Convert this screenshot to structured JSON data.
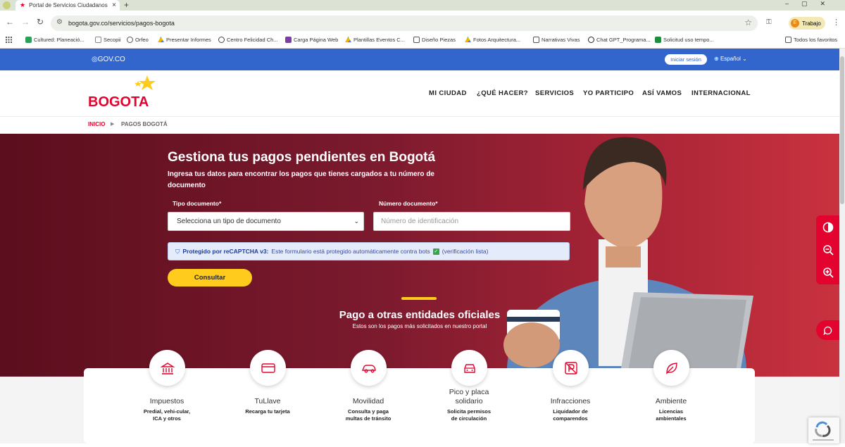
{
  "browser": {
    "tab_title": "Portal de Servicios Ciudadanos",
    "url": "bogota.gov.co/servicios/pagos-bogota",
    "profile_initial": "E",
    "profile_label": "Trabajo",
    "bookmarks": [
      {
        "label": "Cultured: Planeació...",
        "icon": "green-square-icon",
        "color": "#2e9e5b"
      },
      {
        "label": "Secopii",
        "icon": "blank-page-icon",
        "color": "#ffffff"
      },
      {
        "label": "Orfeo",
        "icon": "orfeo-icon",
        "color": "#555555"
      },
      {
        "label": "Presentar Informes",
        "icon": "drive-icon",
        "color": "#f4b400"
      },
      {
        "label": "Centro Felicidad Ch...",
        "icon": "globe-icon",
        "color": "#444444"
      },
      {
        "label": "Carga Página Web",
        "icon": "form-icon",
        "color": "#7b3fa0"
      },
      {
        "label": "Plantillas Eventos C...",
        "icon": "drive-icon",
        "color": "#f4b400"
      },
      {
        "label": "Diseño Piezas",
        "icon": "folder-icon",
        "color": "#555555"
      },
      {
        "label": "Fotos Arquitectura...",
        "icon": "drive-icon",
        "color": "#f4b400"
      },
      {
        "label": "Narrativas Vivas",
        "icon": "folder-icon",
        "color": "#555555"
      },
      {
        "label": "Chat GPT_Programa...",
        "icon": "chatgpt-icon",
        "color": "#222222"
      },
      {
        "label": "Solicitud uso tempo...",
        "icon": "sheets-icon",
        "color": "#1e8e3e"
      },
      {
        "label": "Todos los favoritos",
        "icon": "folder-icon",
        "color": "#555555"
      }
    ]
  },
  "govbar": {
    "brand": "GOV.CO",
    "login": "Iniciar sesión",
    "language": "Español"
  },
  "header": {
    "logo_text": "BOGOTA",
    "nav": [
      "MI CIUDAD",
      "¿QUÉ HACER?",
      "SERVICIOS",
      "YO PARTICIPO",
      "ASÍ VAMOS",
      "INTERNACIONAL"
    ]
  },
  "breadcrumb": {
    "home": "INICIO",
    "current": "PAGOS BOGOTÁ"
  },
  "hero": {
    "title": "Gestiona tus pagos pendientes en Bogotá",
    "subtitle": "Ingresa tus datos para encontrar los pagos que tienes cargados a tu número de documento",
    "tipo_label": "Tipo documento*",
    "tipo_value": "Selecciona un tipo de documento",
    "num_label": "Número documento*",
    "num_placeholder": "Número de identificación",
    "captcha_bold": "Protegido por reCAPTCHA v3:",
    "captcha_text": "Este formulario está protegido automáticamente contra bots",
    "captcha_status": "(verificación lista)",
    "button": "Consultar",
    "otras_title": "Pago a otras entidades oficiales",
    "otras_sub": "Estos son los pagos más solicitados en nuestro portal"
  },
  "services": [
    {
      "title": "Impuestos",
      "desc": "Predial, vehi-cular, ICA y otros",
      "icon": "bank-icon"
    },
    {
      "title": "TuLlave",
      "desc": "Recarga tu tarjeta",
      "icon": "card-icon"
    },
    {
      "title": "Movilidad",
      "desc": "Consulta y paga multas de tránsito",
      "icon": "car-icon"
    },
    {
      "title": "Pico y placa solidario",
      "desc": "Solicita permisos de circulación",
      "icon": "car-front-icon"
    },
    {
      "title": "Infracciones",
      "desc": "Liquidador de comparendos",
      "icon": "no-parking-icon"
    },
    {
      "title": "Ambiente",
      "desc": "Licencias ambientales",
      "icon": "leaf-icon"
    }
  ],
  "colors": {
    "gov_blue": "#3366cc",
    "brand_red": "#e4032e",
    "accent_yellow": "#ffcc1d",
    "hero_dark": "#5b0e1d",
    "hero_light": "#c9323f"
  }
}
